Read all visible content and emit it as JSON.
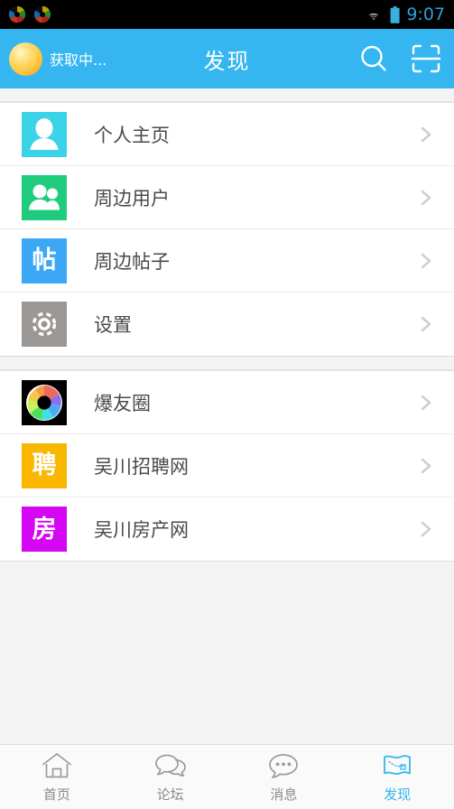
{
  "status_bar": {
    "app_icons": [
      "shutter-icon",
      "shutter-icon"
    ],
    "wifi": "wifi-icon",
    "battery": "battery-icon",
    "time": "9:07",
    "time_color": "#2f9fd8"
  },
  "header": {
    "background_color": "#35b6f0",
    "weather_icon": "sun-icon",
    "weather_text": "获取中...",
    "title": "发现",
    "search_icon_name": "search-icon",
    "scan_icon_name": "qr-scan-icon"
  },
  "groups": [
    {
      "items": [
        {
          "label": "个人主页",
          "icon": "person-icon",
          "tile_class": "tile-cyan",
          "tile_color": "#3ad3e8",
          "glyph": ""
        },
        {
          "label": "周边用户",
          "icon": "people-icon",
          "tile_class": "tile-green",
          "tile_color": "#1fcc7d",
          "glyph": ""
        },
        {
          "label": "周边帖子",
          "icon": "post-icon",
          "tile_class": "tile-blue",
          "tile_color": "#3ca8f5",
          "glyph": "帖"
        },
        {
          "label": "设置",
          "icon": "gear-icon",
          "tile_class": "tile-gray",
          "tile_color": "#9a9795",
          "glyph": ""
        }
      ]
    },
    {
      "items": [
        {
          "label": "爆友圈",
          "icon": "aperture-icon",
          "tile_class": "tile-black",
          "tile_color": "#000000",
          "glyph": ""
        },
        {
          "label": "吴川招聘网",
          "icon": "job-icon",
          "tile_class": "tile-amber",
          "tile_color": "#f9b700",
          "glyph": "聘"
        },
        {
          "label": "吴川房产网",
          "icon": "house-icon",
          "tile_class": "tile-magenta",
          "tile_color": "#d506f2",
          "glyph": "房"
        }
      ]
    }
  ],
  "tabbar": {
    "active_color": "#35b6f0",
    "inactive_color": "#8a8a8a",
    "tabs": [
      {
        "label": "首页",
        "icon": "home-icon",
        "active": false
      },
      {
        "label": "论坛",
        "icon": "forum-icon",
        "active": false
      },
      {
        "label": "消息",
        "icon": "message-icon",
        "active": false
      },
      {
        "label": "发现",
        "icon": "discover-map-icon",
        "active": true
      }
    ]
  }
}
